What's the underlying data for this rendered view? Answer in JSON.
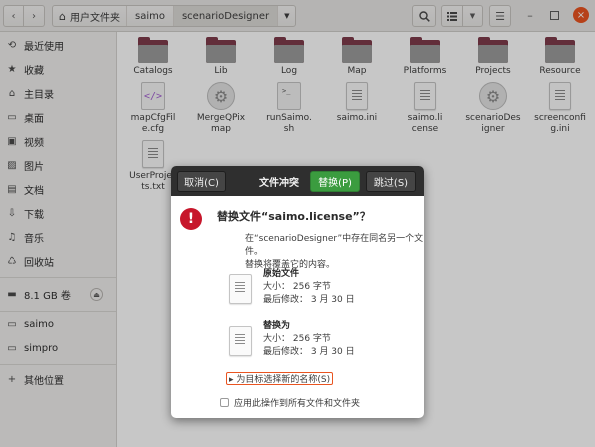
{
  "header": {
    "path": [
      "用户文件夹",
      "saimo",
      "scenarioDesigner"
    ],
    "nav_back_icon": "chevron-left-icon",
    "nav_forward_icon": "chevron-right-icon",
    "path_dropdown_icon": "caret-down-icon",
    "search_icon": "search-icon",
    "view_list_icon": "list-view-icon",
    "view_options_icon": "caret-down-icon",
    "menu_icon": "hamburger-icon",
    "minimize": "–",
    "close": "×"
  },
  "sidebar": {
    "items": [
      {
        "icon": "⟲",
        "label": "最近使用"
      },
      {
        "icon": "★",
        "label": "收藏"
      },
      {
        "icon": "⌂",
        "label": "主目录"
      },
      {
        "icon": "▭",
        "label": "桌面"
      },
      {
        "icon": "▣",
        "label": "视频"
      },
      {
        "icon": "▨",
        "label": "图片"
      },
      {
        "icon": "▤",
        "label": "文档"
      },
      {
        "icon": "⇩",
        "label": "下载"
      },
      {
        "icon": "♫",
        "label": "音乐"
      },
      {
        "icon": "♺",
        "label": "回收站"
      }
    ],
    "volume": {
      "icon": "▬",
      "label": "8.1 GB 卷",
      "eject": "⏏"
    },
    "bookmarks": [
      {
        "icon": "▭",
        "label": "saimo"
      },
      {
        "icon": "▭",
        "label": "simpro"
      }
    ],
    "other": {
      "icon": "+",
      "label": "其他位置"
    }
  },
  "files": [
    {
      "name": "Catalogs",
      "type": "folder"
    },
    {
      "name": "Lib",
      "type": "folder"
    },
    {
      "name": "Log",
      "type": "folder"
    },
    {
      "name": "Map",
      "type": "folder"
    },
    {
      "name": "Platforms",
      "type": "folder"
    },
    {
      "name": "Projects",
      "type": "folder"
    },
    {
      "name": "Resource",
      "type": "folder"
    },
    {
      "name": "mapCfgFile.cfg",
      "type": "xml"
    },
    {
      "name": "MergeQPixmap",
      "type": "gear"
    },
    {
      "name": "runSaimo.sh",
      "type": "term"
    },
    {
      "name": "saimo.ini",
      "type": "doc"
    },
    {
      "name": "saimo.license",
      "type": "doc"
    },
    {
      "name": "scenarioDesigner",
      "type": "gear"
    },
    {
      "name": "screenconfig.ini",
      "type": "doc"
    },
    {
      "name": "UserProjects.txt",
      "type": "doc"
    }
  ],
  "dialog": {
    "cancel": "取消(C)",
    "title": "文件冲突",
    "replace": "替换(P)",
    "skip": "跳过(S)",
    "heading": "替换文件“saimo.license”？",
    "desc1": "在“scenarioDesigner”中存在同名另一个文件。",
    "desc2": "替换将覆盖它的内容。",
    "original_title": "原始文件",
    "original_size": "大小：  256 字节",
    "original_mod": "最后修改：  3 月 30 日",
    "replace_title": "替换为",
    "replace_size": "大小：  256 字节",
    "replace_mod": "最后修改：  3 月 30 日",
    "rename": "▸ 为目标选择新的名称(S)",
    "apply_all": "应用此操作到所有文件和文件夹",
    "warning_icon": "!"
  },
  "colors": {
    "accent": "#e95420",
    "folder": "#7e3c4b",
    "replace_green": "#3b9c3f",
    "warning_red": "#c7162b"
  }
}
